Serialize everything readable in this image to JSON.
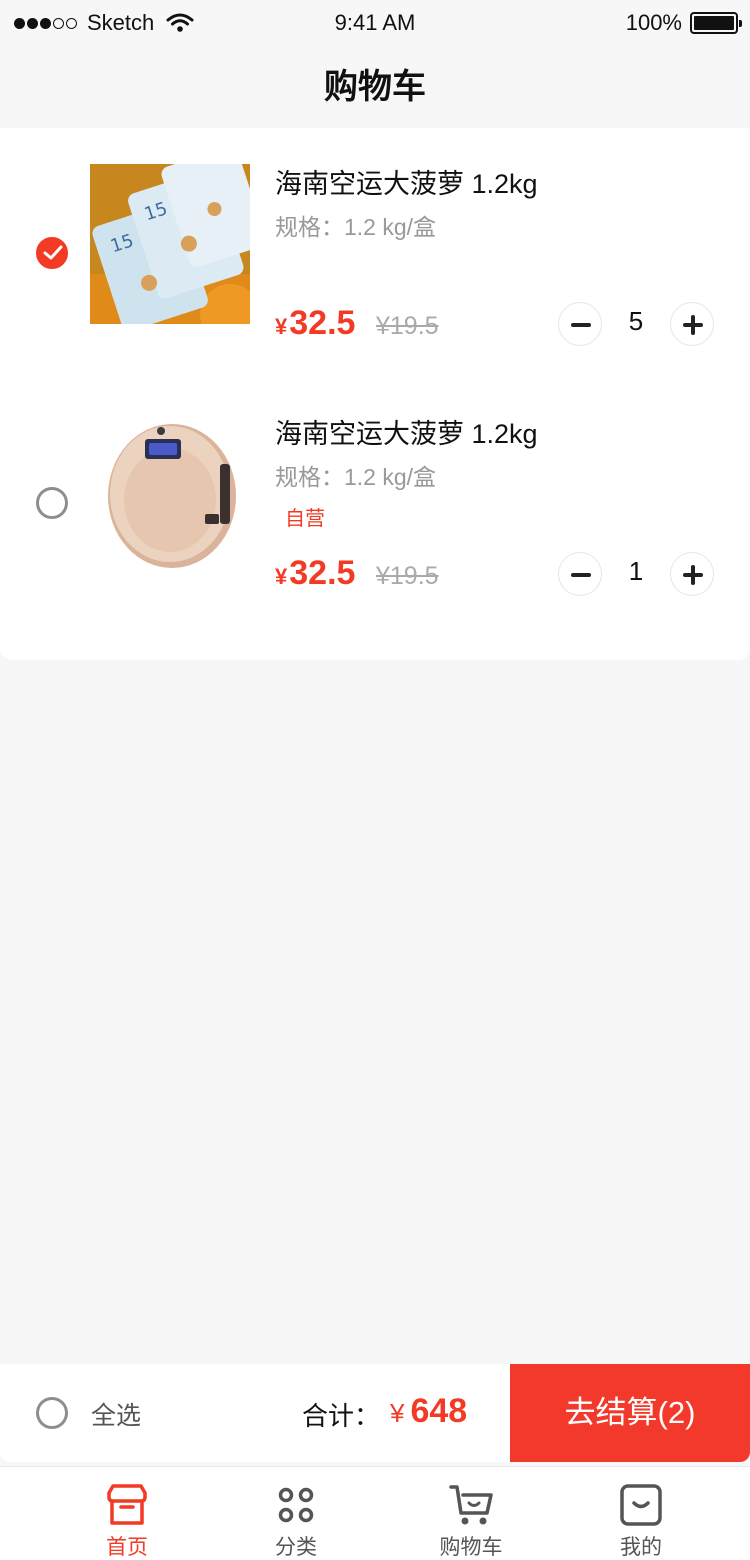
{
  "status_bar": {
    "carrier": "Sketch",
    "time": "9:41 AM",
    "battery": "100%"
  },
  "nav": {
    "title": "购物车"
  },
  "cart": {
    "items": [
      {
        "title": "海南空运大菠萝 1.2kg",
        "spec": "规格：1.2 kg/盒",
        "tag": "",
        "yen": "¥",
        "price": "32.5",
        "original_price": "¥19.5",
        "quantity": "5",
        "checked": true
      },
      {
        "title": "海南空运大菠萝 1.2kg",
        "spec": "规格：1.2 kg/盒",
        "tag": "自营",
        "yen": "¥",
        "price": "32.5",
        "original_price": "¥19.5",
        "quantity": "1",
        "checked": false
      }
    ]
  },
  "checkout": {
    "select_all_label": "全选",
    "total_label": "合计：",
    "total_yen": "¥",
    "total_value": "648",
    "button_label": "去结算(2)"
  },
  "tabs": [
    {
      "label": "首页",
      "icon": "home-store-icon",
      "active": true
    },
    {
      "label": "分类",
      "icon": "category-grid-icon",
      "active": false
    },
    {
      "label": "购物车",
      "icon": "cart-icon",
      "active": false
    },
    {
      "label": "我的",
      "icon": "profile-smile-icon",
      "active": false
    }
  ],
  "colors": {
    "accent": "#f23a24",
    "checkout_button": "#f3392b",
    "background": "#f7f7f7"
  }
}
